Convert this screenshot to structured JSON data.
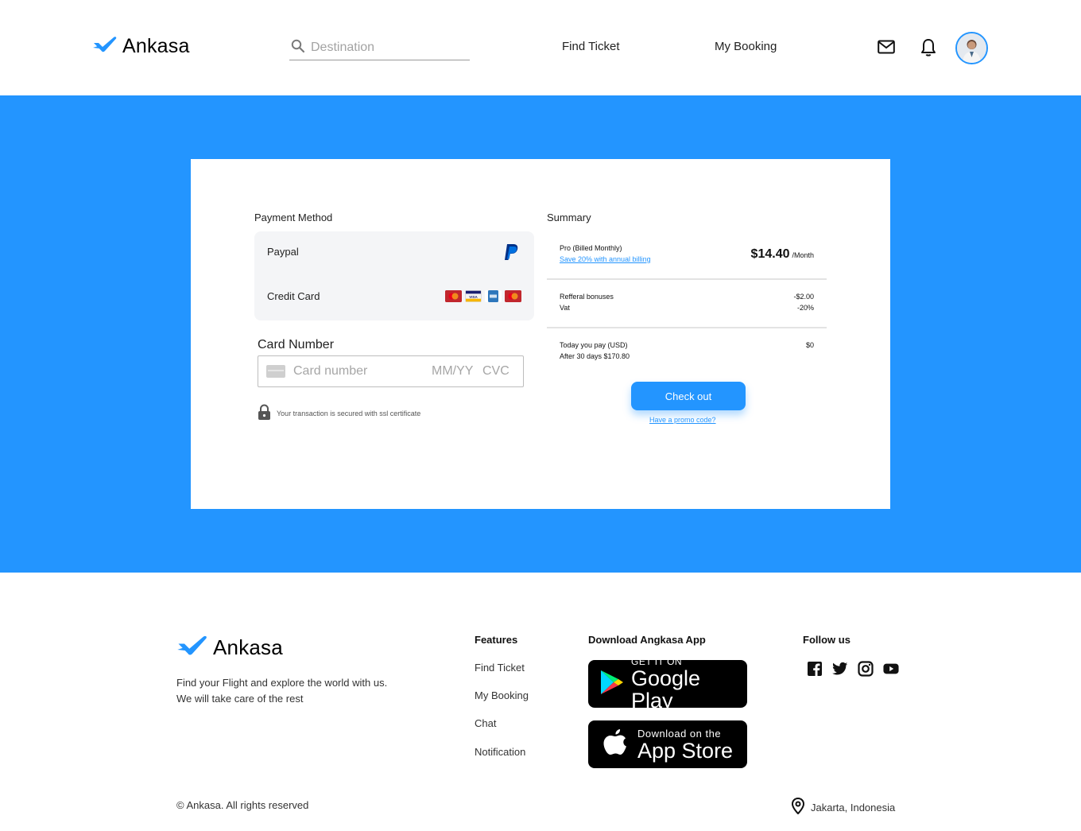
{
  "brand": {
    "name": "Ankasa",
    "accent": "#2395ff"
  },
  "header": {
    "search_placeholder": "Destination",
    "nav": [
      "Find Ticket",
      "My Booking"
    ],
    "icons": [
      "mail-icon",
      "bell-icon"
    ],
    "avatar": "user-avatar"
  },
  "payment": {
    "method_title": "Payment Method",
    "methods": [
      "Paypal",
      "Credit Card"
    ],
    "card_logos": [
      "mastercard",
      "visa",
      "amex",
      "mastercard"
    ],
    "card_number_label": "Card Number",
    "card_number_placeholder": "Card number",
    "expiry_placeholder": "MM/YY",
    "cvc_placeholder": "CVC",
    "ssl_note": "Your transaction is secured with ssl certificate"
  },
  "summary": {
    "title": "Summary",
    "plan": "Pro (Billed Monthly)",
    "save_link": "Save 20% with annual billing",
    "price": "$14.40",
    "price_unit": "/Month",
    "referral_label": "Refferal bonuses",
    "referral_value": "-$2.00",
    "vat_label": "Vat",
    "vat_value": "-20%",
    "today_label": "Today you pay (USD)",
    "today_value": "$0",
    "after_label": "After 30 days $170.80",
    "checkout_button": "Check out",
    "promo_link": "Have a promo code?"
  },
  "footer": {
    "tagline_line1": "Find your Flight and explore the world with us.",
    "tagline_line2": "We will take care of the rest",
    "features_title": "Features",
    "features": [
      "Find Ticket",
      "My Booking",
      "Chat",
      "Notification"
    ],
    "download_title": "Download Angkasa App",
    "google_small": "GET IT ON",
    "google_big": "Google Play",
    "apple_small": "Download on the",
    "apple_big": "App Store",
    "follow_title": "Follow us",
    "socials": [
      "facebook-icon",
      "twitter-icon",
      "instagram-icon",
      "youtube-icon"
    ],
    "copyright": "© Ankasa. All rights reserved",
    "location": "Jakarta, Indonesia"
  }
}
